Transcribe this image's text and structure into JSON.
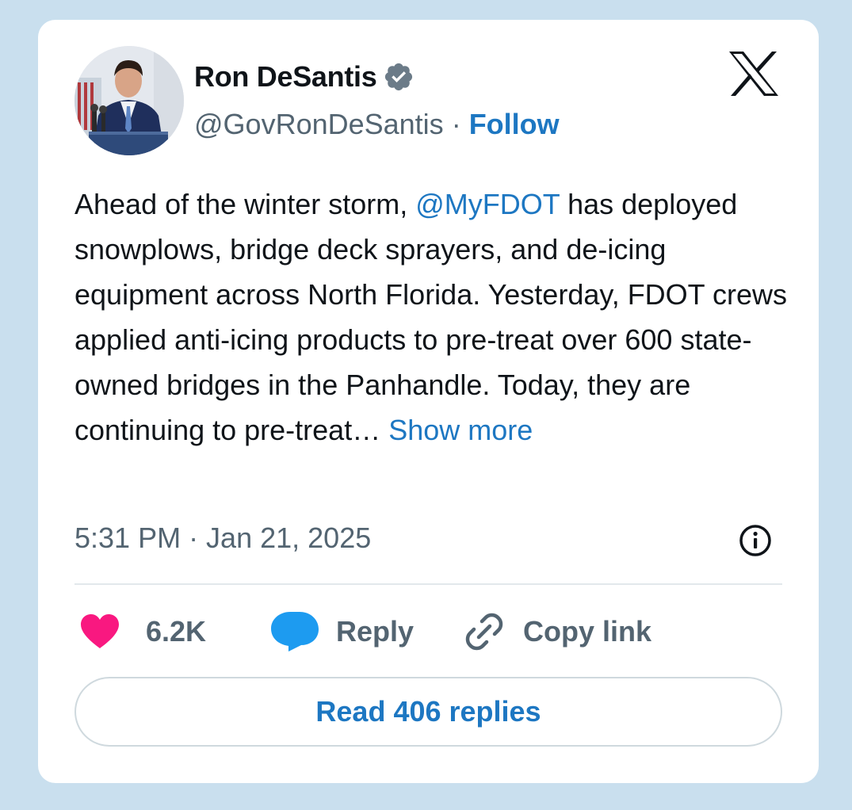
{
  "author": {
    "display_name": "Ron DeSantis",
    "handle": "@GovRonDeSantis",
    "separator": "·",
    "follow_label": "Follow",
    "verified_icon": "verified-badge-icon",
    "avatar": "avatar"
  },
  "brand": {
    "logo": "x-logo-icon"
  },
  "tweet": {
    "text_part1": "Ahead of the winter storm, ",
    "mention": "@MyFDOT",
    "text_part2": " has deployed snowplows, bridge deck sprayers, and de-icing equipment across North Florida. Yesterday, FDOT crews applied anti-icing products to pre-treat over 600 state-owned bridges in the Panhandle. Today, they are continuing to pre-treat… ",
    "show_more_label": "Show more",
    "timestamp": "5:31 PM · Jan 21, 2025"
  },
  "actions": {
    "likes_count": "6.2K",
    "reply_label": "Reply",
    "copy_link_label": "Copy link"
  },
  "read_replies_label": "Read 406 replies",
  "colors": {
    "background": "#c9dfee",
    "card": "#ffffff",
    "link_blue": "#1d77c2",
    "heart_pink": "#f91880",
    "reply_blue": "#1d9bf0",
    "muted_gray": "#536471",
    "text_dark": "#0f1419"
  }
}
